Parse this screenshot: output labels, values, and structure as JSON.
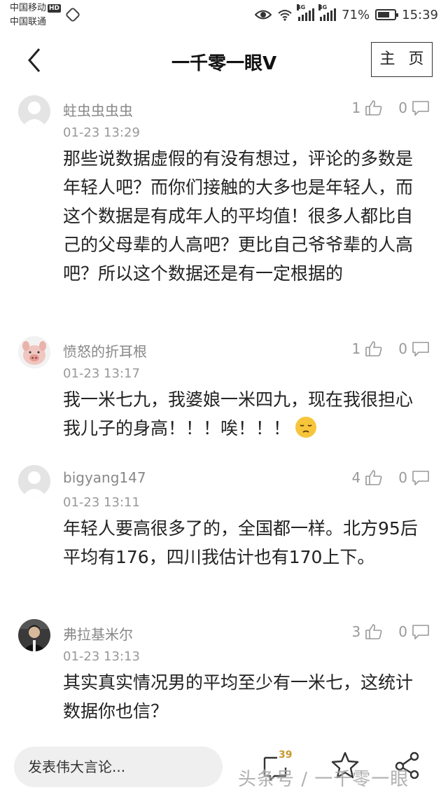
{
  "status_bar": {
    "carrier1": "中国移动",
    "carrier1_badge": "HD",
    "carrier2": "中国联通",
    "network1": "4G",
    "network2": "4G",
    "battery_text": "71%",
    "battery_level": 0.71,
    "time": "15:39"
  },
  "header": {
    "title": "一千零一眼V",
    "home_label": "主 页"
  },
  "comments": [
    {
      "user": "蛀虫虫虫虫",
      "time": "01-23 13:29",
      "likes": "1",
      "replies": "0",
      "text": "那些说数据虚假的有没有想过，评论的多数是年轻人吧？而你们接触的大多也是年轻人，而这个数据是有成年人的平均值！很多人都比自己的父母辈的人高吧？更比自己爷爷辈的人高吧？所以这个数据还是有一定根据的",
      "avatar": "default-avatar"
    },
    {
      "user": "愤怒的折耳根",
      "time": "01-23 13:17",
      "likes": "1",
      "replies": "0",
      "text": "我一米七九，我婆娘一米四九，现在我很担心我儿子的身高！！！唉！！！",
      "emoji": "pensive-face-emoji",
      "avatar": "pig-avatar"
    },
    {
      "user": "bigyang147",
      "time": "01-23 13:11",
      "likes": "4",
      "replies": "0",
      "text": "年轻人要高很多了的，全国都一样。北方95后平均有176，四川我估计也有170上下。",
      "avatar": "default-avatar"
    },
    {
      "user": "弗拉基米尔",
      "time": "01-23 13:13",
      "likes": "3",
      "replies": "0",
      "text": "其实真实情况男的平均至少有一米七，这统计数据你也信？",
      "avatar": "person-avatar"
    }
  ],
  "bottom_bar": {
    "input_placeholder": "发表伟大言论...",
    "comment_count": "39"
  },
  "watermark": "头条号 / 一千零一眼",
  "colors": {
    "text": "#222222",
    "secondary": "#999999",
    "badge": "#c89a2c"
  }
}
